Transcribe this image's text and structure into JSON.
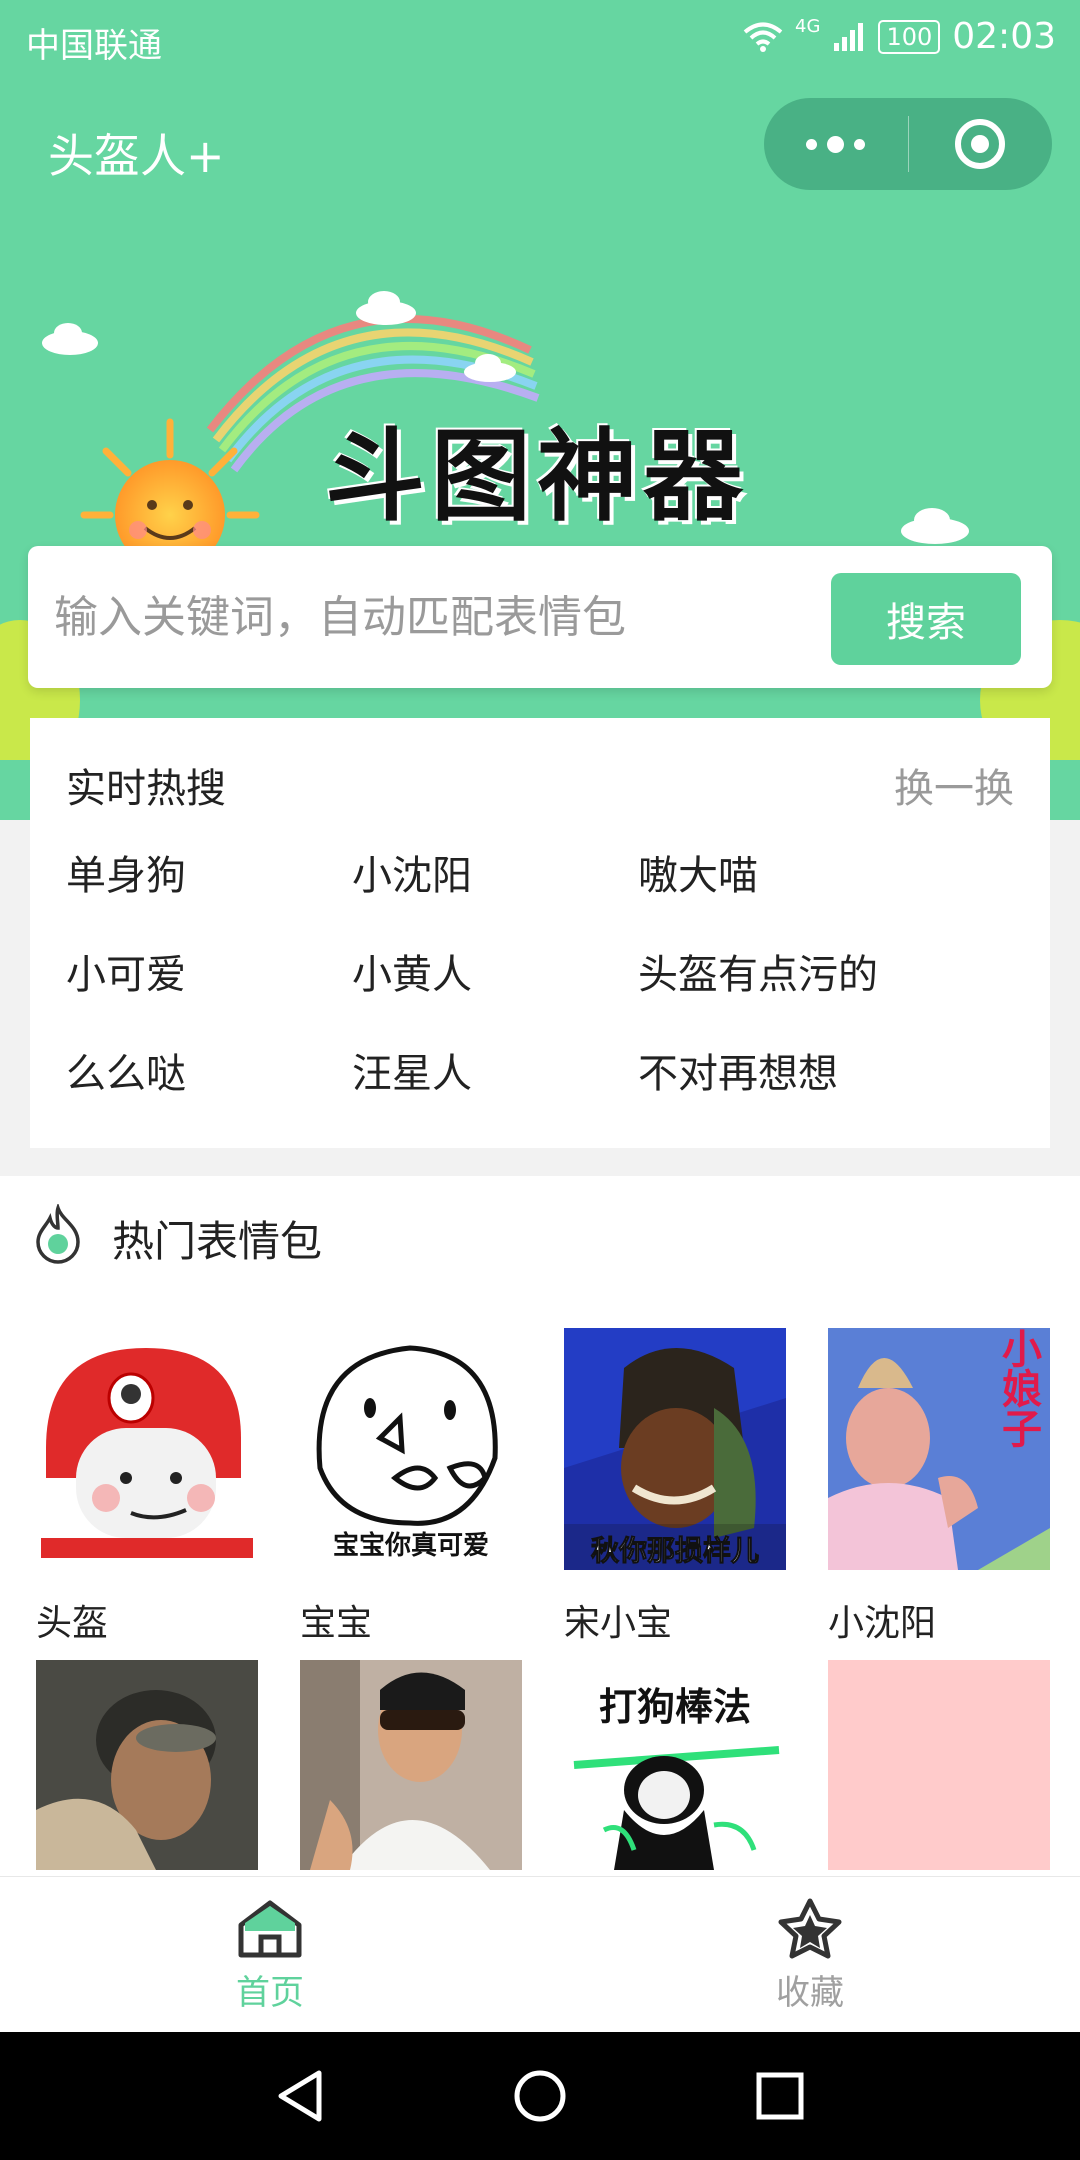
{
  "status_bar": {
    "carrier": "中国联通",
    "network": "4G",
    "battery": "100",
    "time": "02:03"
  },
  "nav": {
    "title": "头盔人+",
    "menu_icon": "more-dots-icon",
    "close_icon": "target-icon"
  },
  "banner": {
    "heading": "斗图神器"
  },
  "search": {
    "placeholder": "输入关键词，自动匹配表情包",
    "button": "搜索"
  },
  "hot_search": {
    "title": "实时热搜",
    "refresh": "换一换",
    "items": [
      "单身狗",
      "小沈阳",
      "嗷大喵",
      "小可爱",
      "小黄人",
      "头盔有点污的",
      "么么哒",
      "汪星人",
      "不对再想想"
    ]
  },
  "hot_stickers": {
    "title": "热门表情包",
    "items": [
      {
        "label": "头盔",
        "caption": ""
      },
      {
        "label": "宝宝",
        "caption": "宝宝你真可爱"
      },
      {
        "label": "宋小宝",
        "caption": "秋你那损样儿"
      },
      {
        "label": "小沈阳",
        "caption": "小娘子"
      },
      {
        "label": "",
        "caption": ""
      },
      {
        "label": "",
        "caption": ""
      },
      {
        "label": "",
        "caption": "打狗棒法"
      },
      {
        "label": "",
        "caption": ""
      }
    ]
  },
  "tabbar": {
    "tabs": [
      {
        "label": "首页",
        "icon": "home-icon",
        "active": true
      },
      {
        "label": "收藏",
        "icon": "star-icon",
        "active": false
      }
    ]
  },
  "colors": {
    "primary": "#66d6a1",
    "button": "#5fd29c",
    "capsule": "#49b185"
  }
}
